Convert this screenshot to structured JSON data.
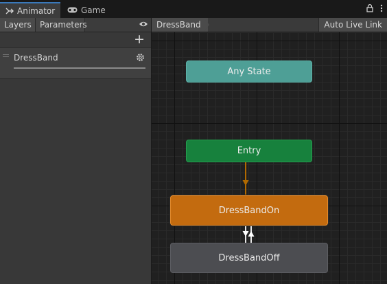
{
  "window": {
    "tabs": [
      {
        "label": "Animator",
        "icon": "animator-icon",
        "active": true
      },
      {
        "label": "Game",
        "icon": "gamepad-icon",
        "active": false
      }
    ],
    "actions": [
      "lock-icon",
      "more-vert-icon"
    ]
  },
  "left_panel": {
    "tabs": [
      {
        "label": "Layers",
        "active": true
      },
      {
        "label": "Parameters",
        "active": false
      }
    ],
    "eye_icon": "eye-icon",
    "add_icon": "plus-icon",
    "layers": [
      {
        "name": "DressBand",
        "weight": 1.0
      }
    ]
  },
  "graph": {
    "breadcrumb": "DressBand",
    "auto_live_link": "Auto Live Link",
    "states": [
      {
        "label": "Any State",
        "color": "#4e9f96"
      },
      {
        "label": "Entry",
        "color": "#17813d"
      },
      {
        "label": "DressBandOn",
        "color": "#c36b0f"
      },
      {
        "label": "DressBandOff",
        "color": "#4c4d51"
      }
    ],
    "transition_color_default": "#b26a00",
    "transition_color_pair": "#ffffff"
  }
}
